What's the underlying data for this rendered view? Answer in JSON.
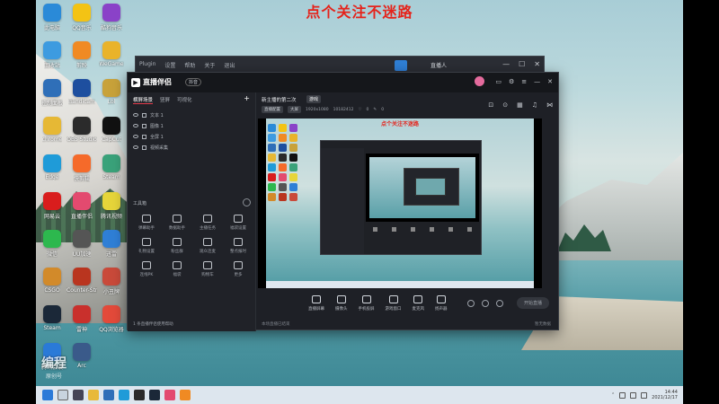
{
  "overlay_title": "点个关注不迷路",
  "desktop_icons": [
    {
      "label": "此电脑",
      "icon": "computer-icon",
      "color": "#2a8ad8"
    },
    {
      "label": "QQ音乐",
      "icon": "qqmusic-icon",
      "color": "#f3c314"
    },
    {
      "label": "酷狗音乐",
      "icon": "music-icon",
      "color": "#8a42c8"
    },
    {
      "label": "回收站",
      "icon": "recycle-bin-icon",
      "color": "#3d9be0"
    },
    {
      "label": "剪映",
      "icon": "app-icon",
      "color": "#f08a23"
    },
    {
      "label": "WeGame",
      "icon": "game-icon",
      "color": "#e9b32a"
    },
    {
      "label": "控制面板",
      "icon": "control-panel-icon",
      "color": "#2f6fb8"
    },
    {
      "label": "Bandicam",
      "icon": "camera-icon",
      "color": "#1e4f9f"
    },
    {
      "label": "Lol",
      "icon": "game-icon",
      "color": "#c8a23a"
    },
    {
      "label": "chrome",
      "icon": "folder-icon",
      "color": "#e6b835"
    },
    {
      "label": "OBS Studio",
      "icon": "obs-icon",
      "color": "#2b2b2b"
    },
    {
      "label": "CapCut",
      "icon": "capcut-icon",
      "color": "#111111"
    },
    {
      "label": "Edge",
      "icon": "edge-icon",
      "color": "#1f9bd8"
    },
    {
      "label": "快剪辑",
      "icon": "app-icon",
      "color": "#f56a2a"
    },
    {
      "label": "Steam",
      "icon": "steam-icon",
      "color": "#3aa27a"
    },
    {
      "label": "网易云",
      "icon": "netease-icon",
      "color": "#d91d1d"
    },
    {
      "label": "直播伴侣",
      "icon": "app-icon",
      "color": "#e34a6f"
    },
    {
      "label": "腾讯视频",
      "icon": "video-icon",
      "color": "#e6d53a"
    },
    {
      "label": "微信",
      "icon": "wechat-icon",
      "color": "#2db84e"
    },
    {
      "label": "UU加速",
      "icon": "app-icon",
      "color": "#555555"
    },
    {
      "label": "迅雷",
      "icon": "app-icon",
      "color": "#2f7fd6"
    },
    {
      "label": "CSGO",
      "icon": "game-icon",
      "color": "#d28a2a"
    },
    {
      "label": "Counter-Strike",
      "icon": "game-icon",
      "color": "#b9351f"
    },
    {
      "label": "小丑牌",
      "icon": "game-icon",
      "color": "#c94a3a"
    },
    {
      "label": "Steam",
      "icon": "steam-icon",
      "color": "#1b2838"
    },
    {
      "label": "雷神",
      "icon": "app-icon",
      "color": "#c9302c"
    },
    {
      "label": "QQ浏览器",
      "icon": "browser-icon",
      "color": "#e34a3a"
    },
    {
      "label": "腾讯会议",
      "icon": "meeting-icon",
      "color": "#2a7ad8"
    },
    {
      "label": "Arc",
      "icon": "app-icon",
      "color": "#3a5a8a"
    }
  ],
  "back_window": {
    "menu": [
      "Plugin",
      "设置",
      "帮助",
      "关于",
      "退出"
    ],
    "user": "直播人"
  },
  "app": {
    "logo_text": "直播伴侣",
    "version": "抖音",
    "left_tabs": [
      "横屏场景",
      "竖屏",
      "可视化"
    ],
    "layers": [
      "文本 1",
      "图像 1",
      "全屏 1",
      "视频采集"
    ],
    "tools_title": "工具箱",
    "tools": [
      "弹幕助手",
      "数据助手",
      "主播任务",
      "福袋设置",
      "礼物设置",
      "粉丝群",
      "观众连麦",
      "整点报时",
      "连线PK",
      "福袋",
      "购物车",
      "更多"
    ],
    "left_footer": "1 条直播伴侣使用帮助",
    "room_title": "新主播的第二次",
    "room_tag": "游戏",
    "sub_chips": [
      "直播配置",
      "大屏"
    ],
    "resolution": "1920x1080",
    "bitrate": "10182412",
    "likes": "0",
    "comments": "0",
    "preview_title": "点个关注不迷路",
    "bottom_tools": [
      "直播屏幕",
      "摄像头",
      "手机投屏",
      "游戏窗口",
      "麦克风",
      "扬声器"
    ],
    "start_button": "开始直播",
    "status_left": "本场直播已结束",
    "status_right": "暂无数据"
  },
  "taskbar": {
    "time": "14:44",
    "date": "2021/12/17"
  },
  "watermark": {
    "line1": "编程",
    "line2": "原创号"
  }
}
